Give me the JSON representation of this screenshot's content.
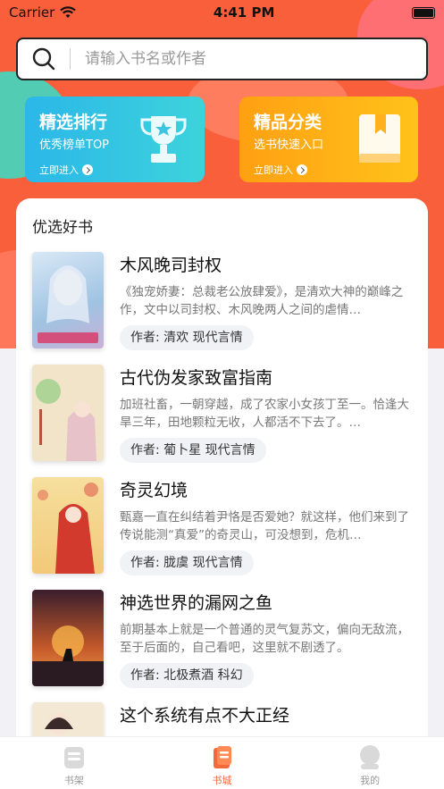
{
  "status_bar": {
    "carrier": "Carrier",
    "time": "4:41 PM"
  },
  "search": {
    "placeholder": "请输入书名或作者"
  },
  "promos": [
    {
      "title": "精选排行",
      "subtitle": "优秀榜单TOP",
      "link": "立即进入",
      "icon": "trophy-icon"
    },
    {
      "title": "精品分类",
      "subtitle": "选书快速入口",
      "link": "立即进入",
      "icon": "book-icon"
    }
  ],
  "section": {
    "title": "优选好书"
  },
  "books": [
    {
      "title": "木风晚司封权",
      "desc": "《独宠娇妻：总裁老公放肆爱》，是清欢大神的巅峰之作，文中以司封权、木风晚两人之间的虐情…",
      "tag": "作者: 清欢  现代言情",
      "cover_color": "#a9c9e6"
    },
    {
      "title": "古代伪发家致富指南",
      "desc": "加班社畜，一朝穿越，成了农家小女孩丁至一。恰逢大旱三年，田地颗粒无收，人都活不下去了。…",
      "tag": "作者: 葡卜星  现代言情",
      "cover_color": "#f1e4c8"
    },
    {
      "title": "奇灵幻境",
      "desc": "甄嘉一直在纠结着尹恪是否爱她？就这样，他们来到了传说能测“真爱”的奇灵山，可没想到，危机…",
      "tag": "作者: 胧虞  现代言情",
      "cover_color": "#f5d38a"
    },
    {
      "title": "神选世界的漏网之鱼",
      "desc": "前期基本上就是一个普通的灵气复苏文，偏向无敌流，至于后面的，自己看吧，这里就不剧透了。",
      "tag": "作者: 北极煮酒  科幻",
      "cover_color": "#e8883a"
    },
    {
      "title": "这个系统有点不大正经",
      "desc": "",
      "tag": "",
      "cover_color": "#f2e8d4"
    }
  ],
  "tabs": [
    {
      "label": "书架",
      "icon": "bookshelf-icon",
      "active": false
    },
    {
      "label": "书城",
      "icon": "bookstore-icon",
      "active": true
    },
    {
      "label": "我的",
      "icon": "profile-icon",
      "active": false
    }
  ],
  "colors": {
    "accent": "#fa5f3c",
    "tab_active": "#f26a3c"
  }
}
